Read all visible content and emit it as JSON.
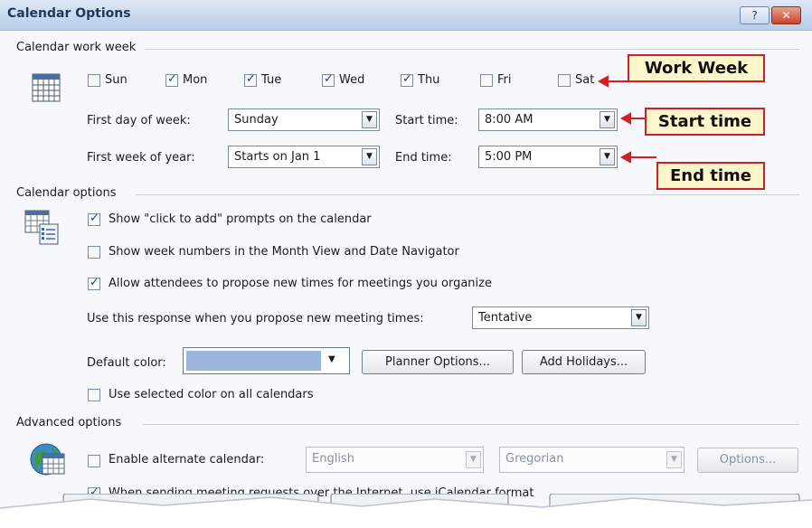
{
  "window": {
    "title": "Calendar Options",
    "help_icon": "help-icon",
    "close_icon": "close-icon"
  },
  "work_week": {
    "section": "Calendar work week",
    "days": [
      {
        "label": "Sun",
        "checked": false
      },
      {
        "label": "Mon",
        "checked": true
      },
      {
        "label": "Tue",
        "checked": true
      },
      {
        "label": "Wed",
        "checked": true
      },
      {
        "label": "Thu",
        "checked": true
      },
      {
        "label": "Fri",
        "checked": false
      },
      {
        "label": "Sat",
        "checked": false
      }
    ],
    "first_day_label": "First day of week:",
    "first_day_value": "Sunday",
    "first_week_label": "First week of year:",
    "first_week_value": "Starts on Jan 1",
    "start_label": "Start time:",
    "start_value": "8:00 AM",
    "end_label": "End time:",
    "end_value": "5:00 PM"
  },
  "callouts": {
    "work_week": "Work Week",
    "start_time": "Start time",
    "end_time": "End time",
    "color": "#d41e24"
  },
  "calendar_options": {
    "section": "Calendar options",
    "show_click_to_add": {
      "label": "Show \"click to add\" prompts on the calendar",
      "checked": true
    },
    "show_week_numbers": {
      "label": "Show week numbers in the Month View and Date Navigator",
      "checked": false
    },
    "allow_propose": {
      "label": "Allow attendees to propose new times for meetings you organize",
      "checked": true
    },
    "response_label": "Use this response when you propose new meeting times:",
    "response_value": "Tentative",
    "default_color_label": "Default color:",
    "default_color": "#9bb6dd",
    "planner_button": "Planner Options...",
    "holidays_button": "Add Holidays...",
    "use_selected_color": {
      "label": "Use selected color on all calendars",
      "checked": false
    }
  },
  "advanced": {
    "section": "Advanced options",
    "alternate": {
      "label": "Enable alternate calendar:",
      "checked": false
    },
    "language_value": "English",
    "calendar_type_value": "Gregorian",
    "options_button": "Options...",
    "icalendar": {
      "label": "When sending meeting requests over the Internet, use iCalendar format",
      "checked": true
    }
  }
}
